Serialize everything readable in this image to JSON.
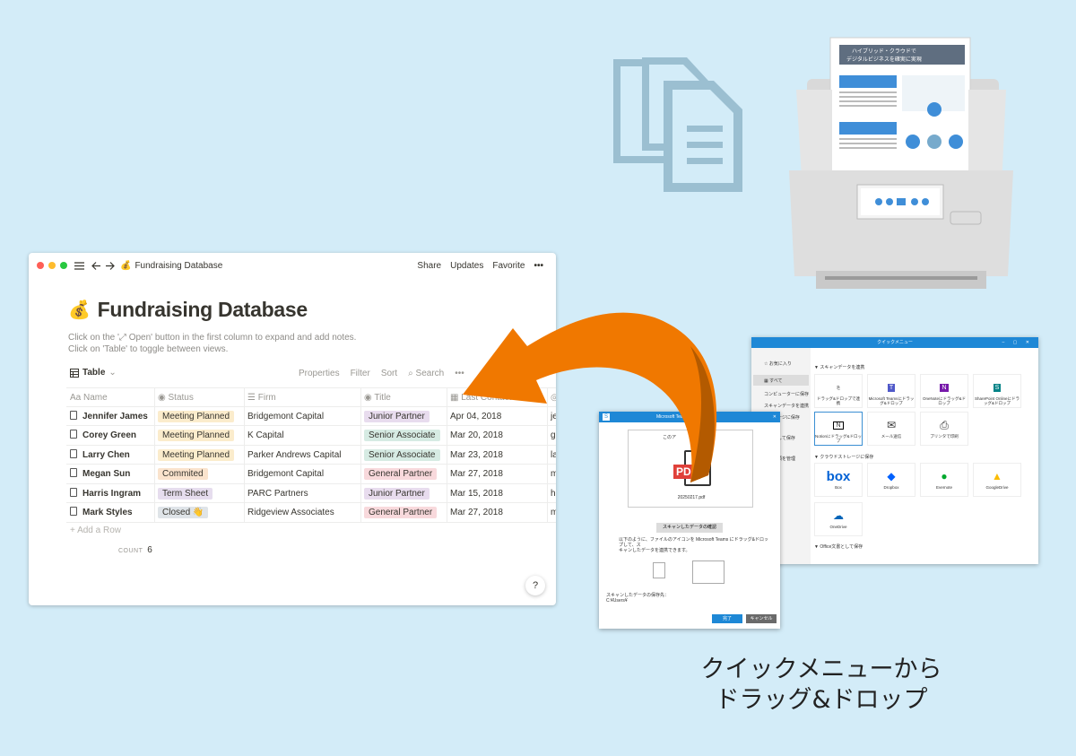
{
  "notion": {
    "breadcrumb_emoji": "💰",
    "breadcrumb": "Fundraising Database",
    "actions": [
      "Share",
      "Updates",
      "Favorite",
      "•••"
    ],
    "title_emoji": "💰",
    "title": "Fundraising Database",
    "help_line1": "Click on the '⤢ Open' button in the first column to expand and add notes.",
    "help_line2": "Click on 'Table' to toggle between views.",
    "view_label": "Table",
    "view_options": [
      "Properties",
      "Filter",
      "Sort",
      "Search",
      "•••"
    ],
    "columns": [
      "Name",
      "Status",
      "Firm",
      "Title",
      "Last Contacted"
    ],
    "rows": [
      {
        "name": "Jennifer James",
        "status": "Meeting Planned",
        "firm": "Bridgemont Capital",
        "title": "Junior Partner",
        "date": "Apr 04, 2018",
        "extra": "je"
      },
      {
        "name": "Corey Green",
        "status": "Meeting Planned",
        "firm": "K Capital",
        "title": "Senior Associate",
        "date": "Mar 20, 2018",
        "extra": "g"
      },
      {
        "name": "Larry Chen",
        "status": "Meeting Planned",
        "firm": "Parker Andrews Capital",
        "title": "Senior Associate",
        "date": "Mar 23, 2018",
        "extra": "la"
      },
      {
        "name": "Megan Sun",
        "status": "Commited",
        "firm": "Bridgemont Capital",
        "title": "General Partner",
        "date": "Mar 27, 2018",
        "extra": "m"
      },
      {
        "name": "Harris Ingram",
        "status": "Term Sheet",
        "firm": "PARC Partners",
        "title": "Junior Partner",
        "date": "Mar 15, 2018",
        "extra": "h"
      },
      {
        "name": "Mark Styles",
        "status": "Closed 👋",
        "firm": "Ridgeview Associates",
        "title": "General Partner",
        "date": "Mar 27, 2018",
        "extra": "m"
      }
    ],
    "add_row": "+ Add a Row",
    "count_label": "COUNT",
    "count_value": "6",
    "help_button": "?"
  },
  "tag_colors": {
    "Meeting Planned": "#fbeccc",
    "Commited": "#fae3cd",
    "Term Sheet": "#e6ddee",
    "Closed 👋": "#dfe4e8",
    "Junior Partner": "#e8dcee",
    "Senior Associate": "#d6ebe3",
    "General Partner": "#f8d9dc"
  },
  "scanner_doc": {
    "headline1": "ハイブリッド・クラウドで",
    "headline2": "デジタルビジネスを確実に実現"
  },
  "quick_menu": {
    "title": "クイックメニュー",
    "sidebar": [
      "お気に入り",
      "すべて",
      "コンピューターに保存",
      "スキャンデータを連携",
      "ストレージに保存",
      "に送信して保存",
      "会計書類を管理",
      "理"
    ],
    "section1": "▼ スキャンデータを連携",
    "tiles1": [
      "ドラッグ&ドロップで連携",
      "Microsoft Teamsにドラッグ&ドロップ",
      "OneNoteにドラッグ&ドロップ",
      "SharePoint Onlineにドラッグ&ドロップ",
      "Notionにドラッグ&ドロップ",
      "メール送信",
      "プリンタで印刷"
    ],
    "section2": "▼ クラウドストレージに保存",
    "tiles2": [
      "Box",
      "Dropbox",
      "Evernote",
      "GoogleDrive",
      "OneDrive"
    ],
    "box_logo": "box",
    "section3": "▼ Office文書として保存"
  },
  "dialog": {
    "title": "Microsoft Teams",
    "top_text": "このア",
    "file_icon_label": "PDF",
    "file_name": "20250217.pdf",
    "confirm_button": "スキャンしたデータの確認",
    "instructions1": "以下のように、ファイルのアイコンを Microsoft Teams にドラッグ&ドロップして、ス",
    "instructions2": "キャンしたデータを連携できます。",
    "save_label": "スキャンしたデータの保存先：",
    "save_path": "C:¥Users¥",
    "ok": "完了",
    "cancel": "キャンセル"
  },
  "caption": {
    "line1": "クイックメニューから",
    "line2": "ドラッグ&ドロップ"
  },
  "colors": {
    "background": "#d3ecf8",
    "arrow": "#f07800",
    "doc_icon": "#9bbfd1",
    "titlebar_blue": "#1e88d6"
  }
}
